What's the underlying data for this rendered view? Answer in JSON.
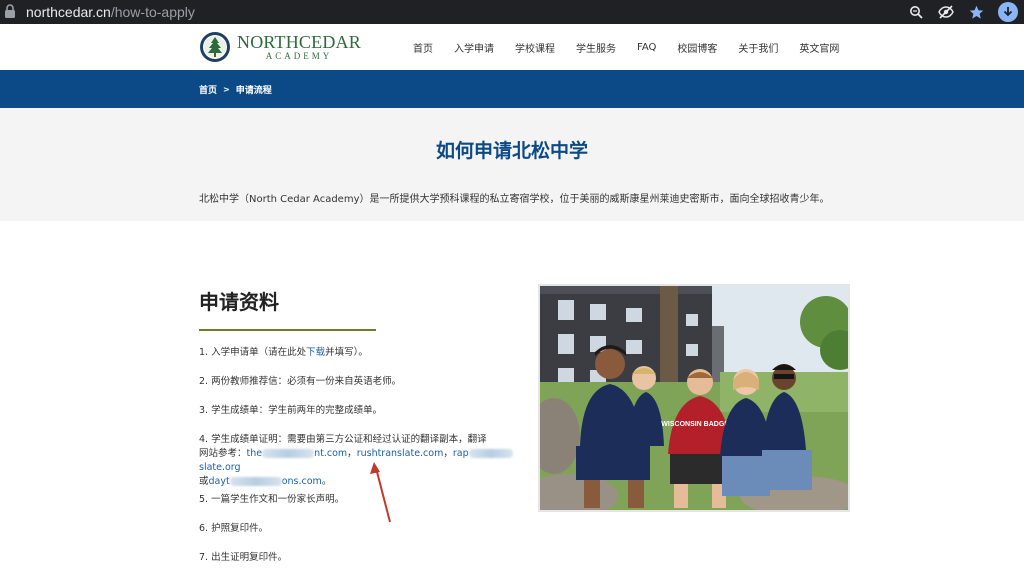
{
  "browser": {
    "url_host": "northcedar.cn",
    "url_path": "/how-to-apply"
  },
  "header": {
    "logo_main": "NORTHCEDAR",
    "logo_sub": "ACADEMY",
    "nav": [
      "首页",
      "入学申请",
      "学校课程",
      "学生服务",
      "FAQ",
      "校园博客",
      "关于我们",
      "英文官网"
    ]
  },
  "breadcrumb": {
    "home": "首页",
    "separator": ">",
    "current": "申请流程"
  },
  "intro": {
    "title": "如何申请北松中学",
    "text": "北松中学（North Cedar Academy）是一所提供大学预科课程的私立寄宿学校，位于美丽的威斯康星州莱迪史密斯市，面向全球招收青少年。"
  },
  "materials": {
    "title": "申请资料",
    "item1_pre": "1. 入学申请单（请在此处",
    "item1_link": "下载",
    "item1_post": "并填写）。",
    "item2": "2. 两份教师推荐信：必须有一份来自英语老师。",
    "item3": "3. 学生成绩单：学生前两年的完整成绩单。",
    "item4_line1": "4. 学生成绩单证明：需要由第三方公证和经过认证的翻译副本，翻译",
    "item4_line2_pre": "网站参考：",
    "item4_link1_a": "the",
    "item4_link1_b": "nt.com",
    "item4_comma": "，",
    "item4_link2": "rushtranslate.com",
    "item4_link3_a": "rap",
    "item4_link3_b": "slate.org",
    "item4_line3_pre": "或",
    "item4_link4_a": "dayt",
    "item4_link4_b": "ons.com",
    "item4_end": "。",
    "item5": "5. 一篇学生作文和一份家长声明。",
    "item6": "6. 护照复印件。",
    "item7": "7. 出生证明复印件。"
  },
  "photo": {
    "shirt_text": "WISCONSIN BADGERS"
  },
  "colors": {
    "brand_blue": "#0b4a86",
    "brand_green": "#2e6b3c",
    "link_blue": "#1d5fa8",
    "rule_olive": "#6d7d2a",
    "annotation_red": "#c0392b"
  }
}
